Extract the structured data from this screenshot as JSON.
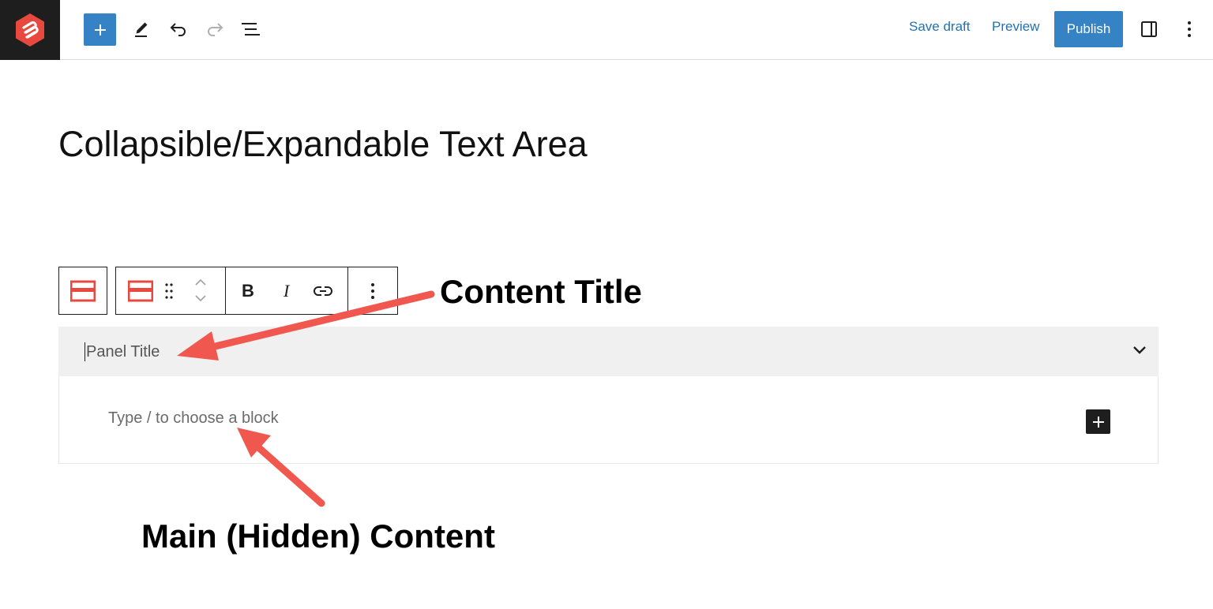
{
  "toolbar": {
    "save_draft": "Save draft",
    "preview": "Preview",
    "publish": "Publish",
    "icons": [
      "site-logo",
      "plus-icon",
      "pencil-icon",
      "undo-icon",
      "redo-icon",
      "list-view-icon",
      "sidebar-toggle-icon",
      "more-options-icon"
    ],
    "accent_color": "#3582c4"
  },
  "post": {
    "title": "Collapsible/Expandable Text Area"
  },
  "block_toolbar": {
    "bold": "B",
    "italic": "I",
    "icons": [
      "accordion-block-icon",
      "drag-handle-icon",
      "move-up-icon",
      "move-down-icon",
      "link-icon",
      "block-options-icon"
    ]
  },
  "accordion": {
    "panel_title_placeholder": "Panel Title",
    "content_placeholder": "Type / to choose a block"
  },
  "annotations": {
    "content_title": "Content Title",
    "main_content": "Main (Hidden) Content",
    "arrow_color": "#f0584f"
  }
}
